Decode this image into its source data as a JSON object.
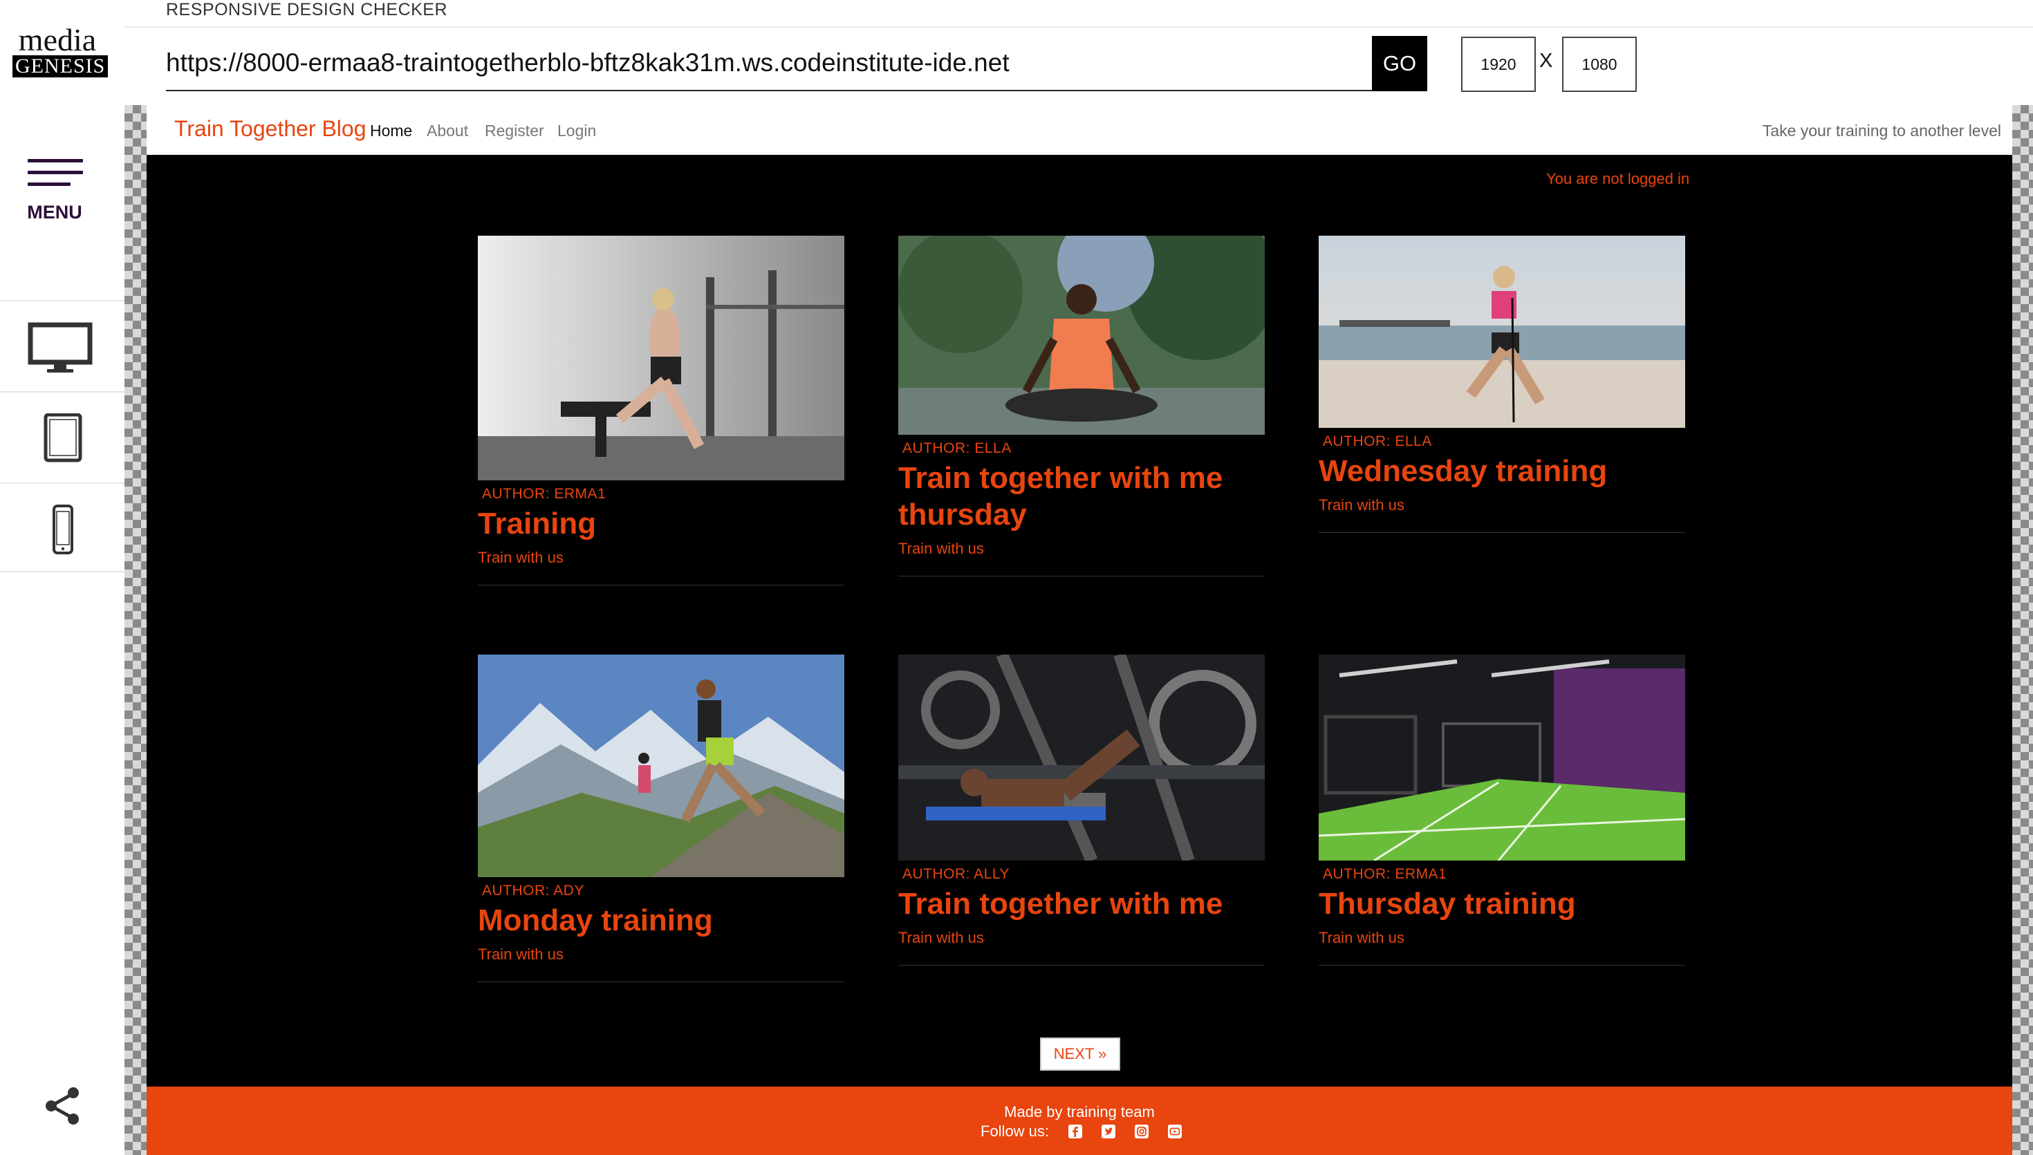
{
  "tool": {
    "logo_top": "media",
    "logo_bottom": "GENESIS",
    "menu_label": "MENU",
    "title": "RESPONSIVE DESIGN CHECKER",
    "url": "https://8000-ermaa8-traintogetherblo-bftz8kak31m.ws.codeinstitute-ide.net",
    "go_label": "GO",
    "width_value": "1920",
    "height_value": "1080",
    "dimension_separator": "X",
    "devices": [
      "desktop-icon",
      "tablet-icon",
      "mobile-icon"
    ],
    "share_icon": "share-icon"
  },
  "site": {
    "brand": "Train Together Blog",
    "nav": [
      "Home",
      "About",
      "Register",
      "Login"
    ],
    "tagline": "Take your training to another level",
    "login_status": "You are not logged in",
    "accent_color": "#e8450f",
    "posts": [
      {
        "author": "AUTHOR: ERMA1",
        "title": "Training",
        "excerpt": "Train with us"
      },
      {
        "author": "AUTHOR: ELLA",
        "title": "Train together with me thursday",
        "excerpt": "Train with us"
      },
      {
        "author": "AUTHOR: ELLA",
        "title": "Wednesday training",
        "excerpt": "Train with us"
      },
      {
        "author": "AUTHOR: ADY",
        "title": "Monday training",
        "excerpt": "Train with us"
      },
      {
        "author": "AUTHOR: ALLY",
        "title": "Train together with me",
        "excerpt": "Train with us"
      },
      {
        "author": "AUTHOR: ERMA1",
        "title": "Thursday training",
        "excerpt": "Train with us"
      }
    ],
    "next_label": "NEXT »",
    "footer_made": "Made by training team",
    "footer_follow": "Follow us:",
    "social_icons": [
      "facebook-icon",
      "twitter-icon",
      "instagram-icon",
      "youtube-icon"
    ]
  }
}
